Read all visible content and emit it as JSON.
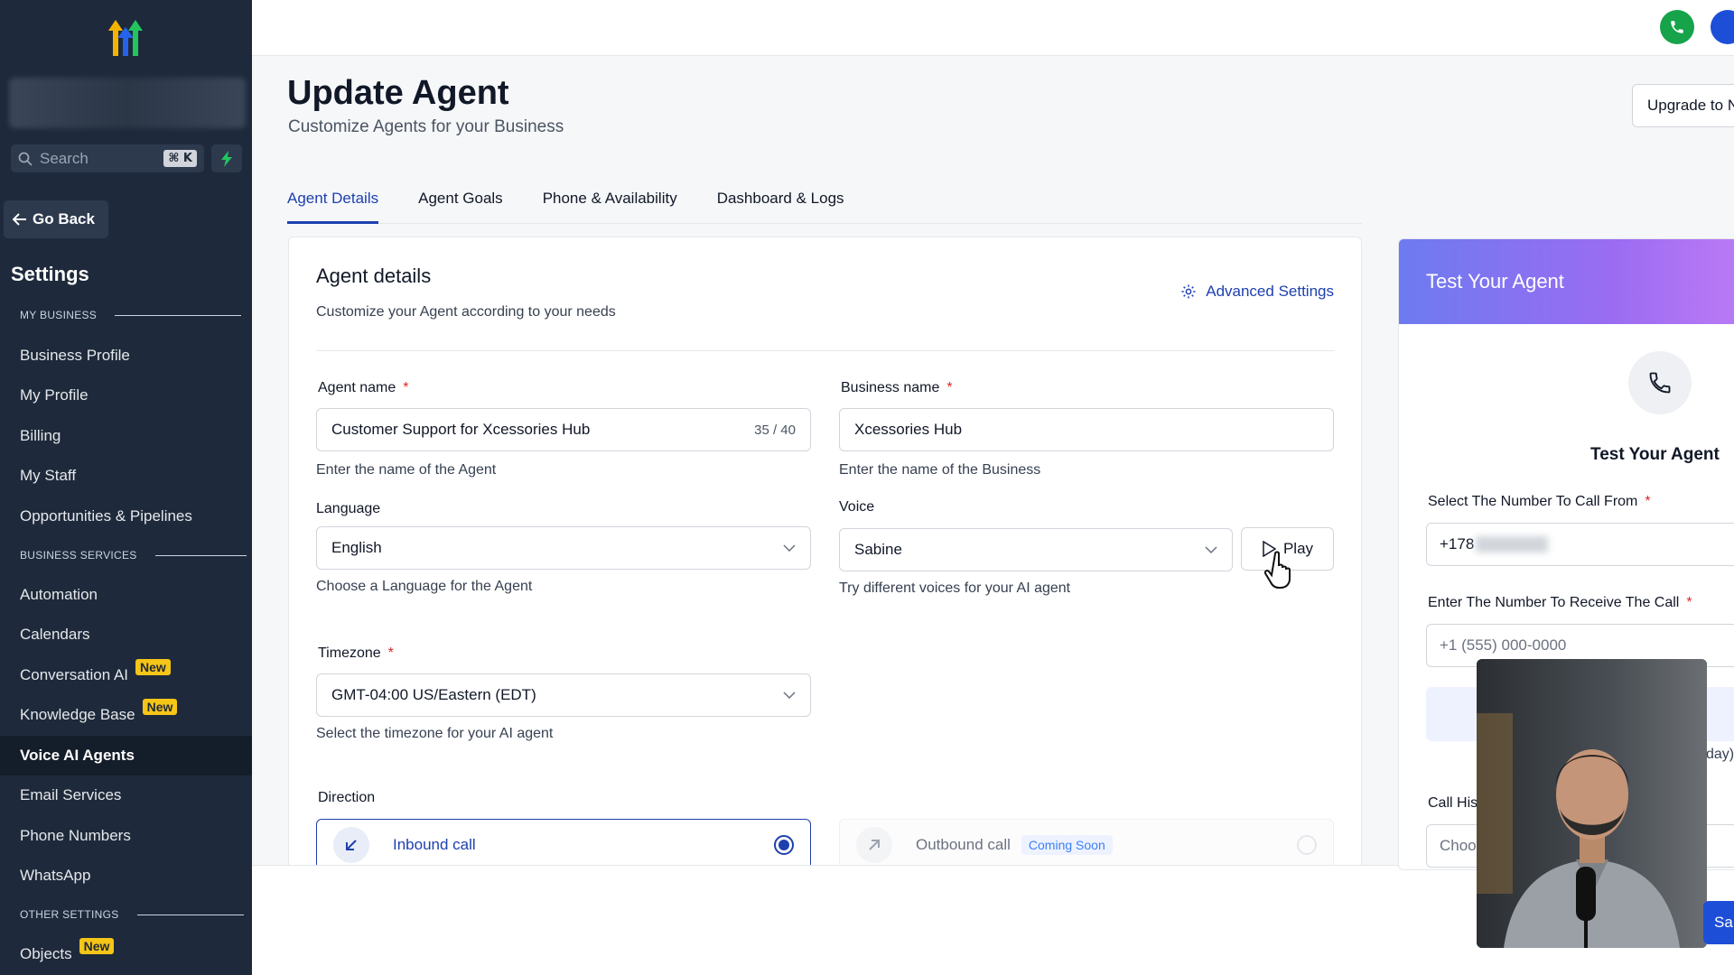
{
  "sidebar": {
    "search_placeholder": "Search",
    "shortcut": "⌘ K",
    "go_back": "Go Back",
    "settings_title": "Settings",
    "sections": {
      "my_business": "MY BUSINESS",
      "business_services": "BUSINESS SERVICES",
      "other_settings": "OTHER SETTINGS"
    },
    "items": [
      {
        "label": "Business Profile"
      },
      {
        "label": "My Profile"
      },
      {
        "label": "Billing"
      },
      {
        "label": "My Staff"
      },
      {
        "label": "Opportunities & Pipelines"
      },
      {
        "label": "Automation"
      },
      {
        "label": "Calendars"
      },
      {
        "label": "Conversation AI",
        "badge": "New"
      },
      {
        "label": "Knowledge Base",
        "badge": "New"
      },
      {
        "label": "Voice AI Agents"
      },
      {
        "label": "Email Services"
      },
      {
        "label": "Phone Numbers"
      },
      {
        "label": "WhatsApp"
      },
      {
        "label": "Objects",
        "badge": "New"
      }
    ]
  },
  "header": {
    "title": "Update Agent",
    "subtitle": "Customize Agents for your Business",
    "upgrade_label": "Upgrade to N"
  },
  "tabs": [
    {
      "label": "Agent Details"
    },
    {
      "label": "Agent Goals"
    },
    {
      "label": "Phone & Availability"
    },
    {
      "label": "Dashboard & Logs"
    }
  ],
  "card": {
    "title": "Agent details",
    "subtitle": "Customize your Agent according to your needs",
    "advanced_settings": "Advanced Settings",
    "agent_name": {
      "label": "Agent name",
      "value": "Customer Support for Xcessories Hub",
      "counter": "35 / 40",
      "helper": "Enter the name of the Agent"
    },
    "business_name": {
      "label": "Business name",
      "value": "Xcessories Hub",
      "helper": "Enter the name of the Business"
    },
    "language": {
      "label": "Language",
      "value": "English",
      "helper": "Choose a Language for the Agent"
    },
    "voice": {
      "label": "Voice",
      "value": "Sabine",
      "helper": "Try different voices for your AI agent",
      "play_label": "Play"
    },
    "timezone": {
      "label": "Timezone",
      "value": "GMT-04:00 US/Eastern (EDT)",
      "helper": "Select the timezone for your AI agent"
    },
    "direction": {
      "label": "Direction",
      "inbound": "Inbound call",
      "outbound": "Outbound call",
      "coming_soon": "Coming Soon"
    },
    "required_mark": "*"
  },
  "test_panel": {
    "header": "Test Your Agent",
    "title": "Test Your Agent",
    "from_label": "Select The Number To Call From",
    "from_value": "+178",
    "receive_label": "Enter The Number To Receive The Call",
    "receive_placeholder": "+1 (555) 000-0000",
    "day_text": "day)",
    "call_history_label": "Call His",
    "choose_placeholder": "Choo",
    "save_label": "Sa"
  },
  "colors": {
    "sidebar_bg": "#1e2a3b",
    "accent": "#1e40af",
    "new_badge": "#f5c518",
    "call_green": "#16a34a"
  }
}
